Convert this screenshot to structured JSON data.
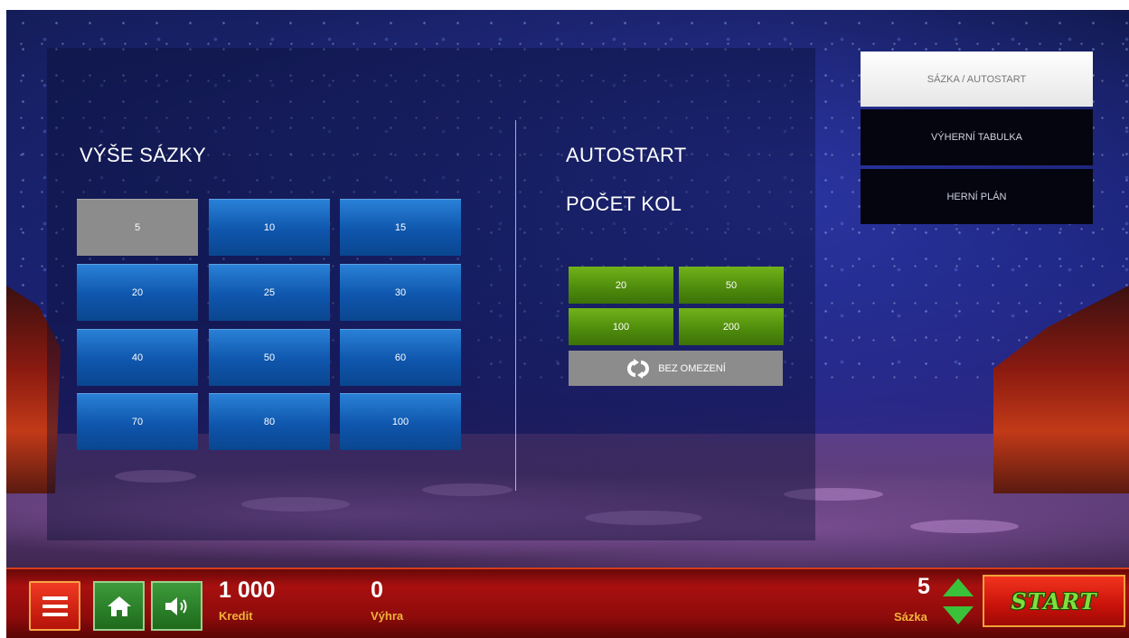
{
  "bet_section": {
    "title": "VÝŠE SÁZKY",
    "options": [
      "5",
      "10",
      "15",
      "20",
      "25",
      "30",
      "40",
      "50",
      "60",
      "70",
      "80",
      "100"
    ],
    "selected": "5"
  },
  "autostart_section": {
    "title": "AUTOSTART",
    "subtitle": "POČET KOL",
    "options": [
      "20",
      "50",
      "100",
      "200"
    ],
    "unlimited_label": "BEZ OMEZENÍ",
    "unlimited_icon": "loop-icon"
  },
  "side_menu": {
    "items": [
      "SÁZKA / AUTOSTART",
      "VÝHERNÍ TABULKA",
      "HERNÍ PLÁN"
    ],
    "active": "SÁZKA / AUTOSTART"
  },
  "bottom_bar": {
    "credit_value": "1 000",
    "credit_label": "Kredit",
    "win_value": "0",
    "win_label": "Výhra",
    "bet_value": "5",
    "bet_label": "Sázka",
    "start_label": "START",
    "icons": [
      "menu-icon",
      "home-icon",
      "speaker-icon",
      "arrow-up-icon",
      "arrow-down-icon"
    ]
  },
  "colors": {
    "bet_button": "#0f56ad",
    "selected_button": "#8c8c8c",
    "autostart_button": "#4d8a0c",
    "bottom_bar": "#a8100f",
    "label_gold": "#f0b33a"
  }
}
